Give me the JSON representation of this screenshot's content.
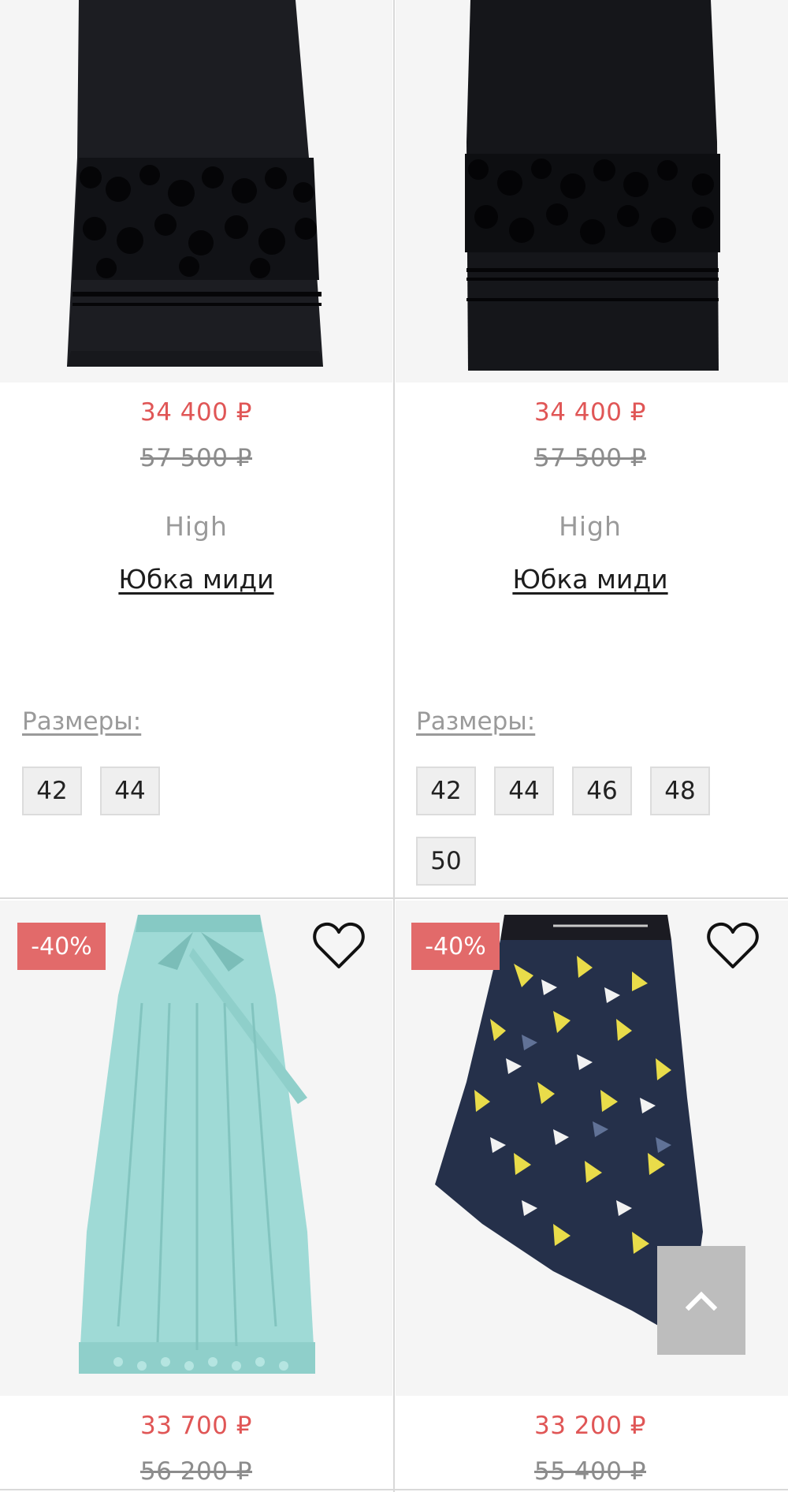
{
  "products": [
    {
      "price_new": "34 400 ₽",
      "price_old": "57 500 ₽",
      "brand": "High",
      "title": "Юбка миди",
      "sizes_label": "Размеры:",
      "sizes": [
        "42",
        "44"
      ],
      "image_icon": "black-midi-skirt-image"
    },
    {
      "price_new": "34 400 ₽",
      "price_old": "57 500 ₽",
      "brand": "High",
      "title": "Юбка миди",
      "sizes_label": "Размеры:",
      "sizes": [
        "42",
        "44",
        "46",
        "48",
        "50"
      ],
      "image_icon": "black-midi-skirt-image"
    },
    {
      "badge": "-40%",
      "price_new": "33 700 ₽",
      "price_old": "56 200 ₽",
      "image_icon": "mint-skirt-image",
      "favorite_icon": "heart-icon"
    },
    {
      "badge": "-40%",
      "price_new": "33 200 ₽",
      "price_old": "55 400 ₽",
      "image_icon": "printed-asymmetric-skirt-image",
      "favorite_icon": "heart-icon"
    }
  ],
  "scroll_top_icon": "chevron-up-icon",
  "colors": {
    "sale_price": "#e05656",
    "badge": "#e26a6a",
    "divider": "#d9d9d9",
    "chip_bg": "#efefef",
    "scroll_button": "#bdbdbd"
  }
}
